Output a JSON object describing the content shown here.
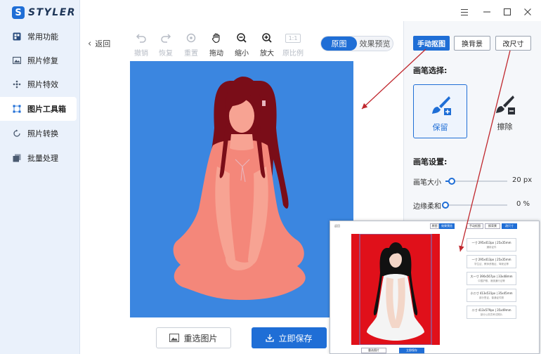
{
  "app": {
    "logo_letter": "S",
    "name": "STYLER"
  },
  "sidebar": {
    "items": [
      {
        "label": "常用功能",
        "icon": "star-icon"
      },
      {
        "label": "照片修复",
        "icon": "photo-repair-icon"
      },
      {
        "label": "照片特效",
        "icon": "sparkle-icon"
      },
      {
        "label": "图片工具箱",
        "icon": "toolbox-icon"
      },
      {
        "label": "照片转换",
        "icon": "convert-icon"
      },
      {
        "label": "批量处理",
        "icon": "batch-icon"
      }
    ],
    "active_index": 3
  },
  "toolbar": {
    "back_label": "返回",
    "undo_label": "撤销",
    "redo_label": "恢复",
    "reset_label": "重置",
    "drag_label": "拖动",
    "zoom_out_label": "缩小",
    "zoom_in_label": "放大",
    "original_ratio_label": "原比例",
    "ratio_badge": "1:1",
    "view_toggle": {
      "original": "原图",
      "preview": "效果预览",
      "selected": "original"
    }
  },
  "bottom": {
    "reselect_label": "重选图片",
    "save_label": "立即保存"
  },
  "right_panel": {
    "tabs": [
      {
        "label": "手动抠图",
        "active": true
      },
      {
        "label": "换背景",
        "active": false
      },
      {
        "label": "改尺寸",
        "active": false
      }
    ],
    "brush_section_title": "画笔选择:",
    "brush_keep_label": "保留",
    "brush_erase_label": "擦除",
    "settings_title": "画笔设置:",
    "brush_size": {
      "label": "画笔大小",
      "value": 20,
      "unit": "px",
      "display": "20 px",
      "fraction": 0.1
    },
    "edge_soft": {
      "label": "边缘柔和",
      "value": 0,
      "unit": "%",
      "display": "0 %",
      "fraction": 0.0
    }
  },
  "inset": {
    "back_label": "返回",
    "toggle_original": "原图",
    "toggle_preview": "效果预览",
    "tabs": [
      "手动抠图",
      "换背景",
      "改尺寸"
    ],
    "cards": [
      {
        "title": "一寸 295x413px | 25x35mm",
        "sub": "通用证件"
      },
      {
        "title": "一寸 295x413px | 25x35mm",
        "sub": "学生证、教师资格证、驾驶证等"
      },
      {
        "title": "大一寸 390x567px | 33x48mm",
        "sub": "中国护照、港澳通行证等"
      },
      {
        "title": "小二寸 413x531px | 35x45mm",
        "sub": "部分签证、普通证件照"
      },
      {
        "title": "二寸 413x579px | 35x49mm",
        "sub": "部分公务员考试照片"
      }
    ],
    "reselect_label": "重选图片",
    "save_label": "立即保存"
  },
  "colors": {
    "accent": "#1f6ed6",
    "canvas_bg": "#3b86e0",
    "inset_bg": "#e0101a",
    "arrow": "#c0272d",
    "sidebar_bg": "#eaf1fb"
  },
  "window_controls": [
    "menu-icon",
    "minimize-icon",
    "maximize-icon",
    "close-icon"
  ]
}
